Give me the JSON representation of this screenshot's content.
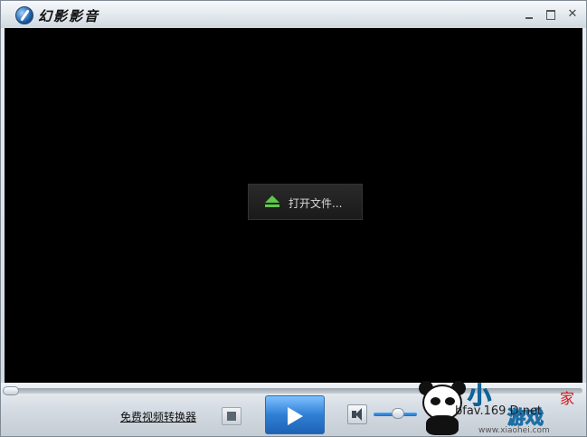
{
  "window": {
    "title": "幻影影音",
    "controls": {
      "minimize": "",
      "maximize": "",
      "close": "✕"
    }
  },
  "video": {
    "open_file_label": "打开文件..."
  },
  "controlbar": {
    "progress": 0,
    "converter_link": "免费视频转换器",
    "volume": 0.6
  },
  "watermark": {
    "brand_small": "小",
    "brand_game": "游戏",
    "brand_home": "家",
    "url": "www.xiaohei.com"
  },
  "overlay_text": "bfav.169 D.net"
}
